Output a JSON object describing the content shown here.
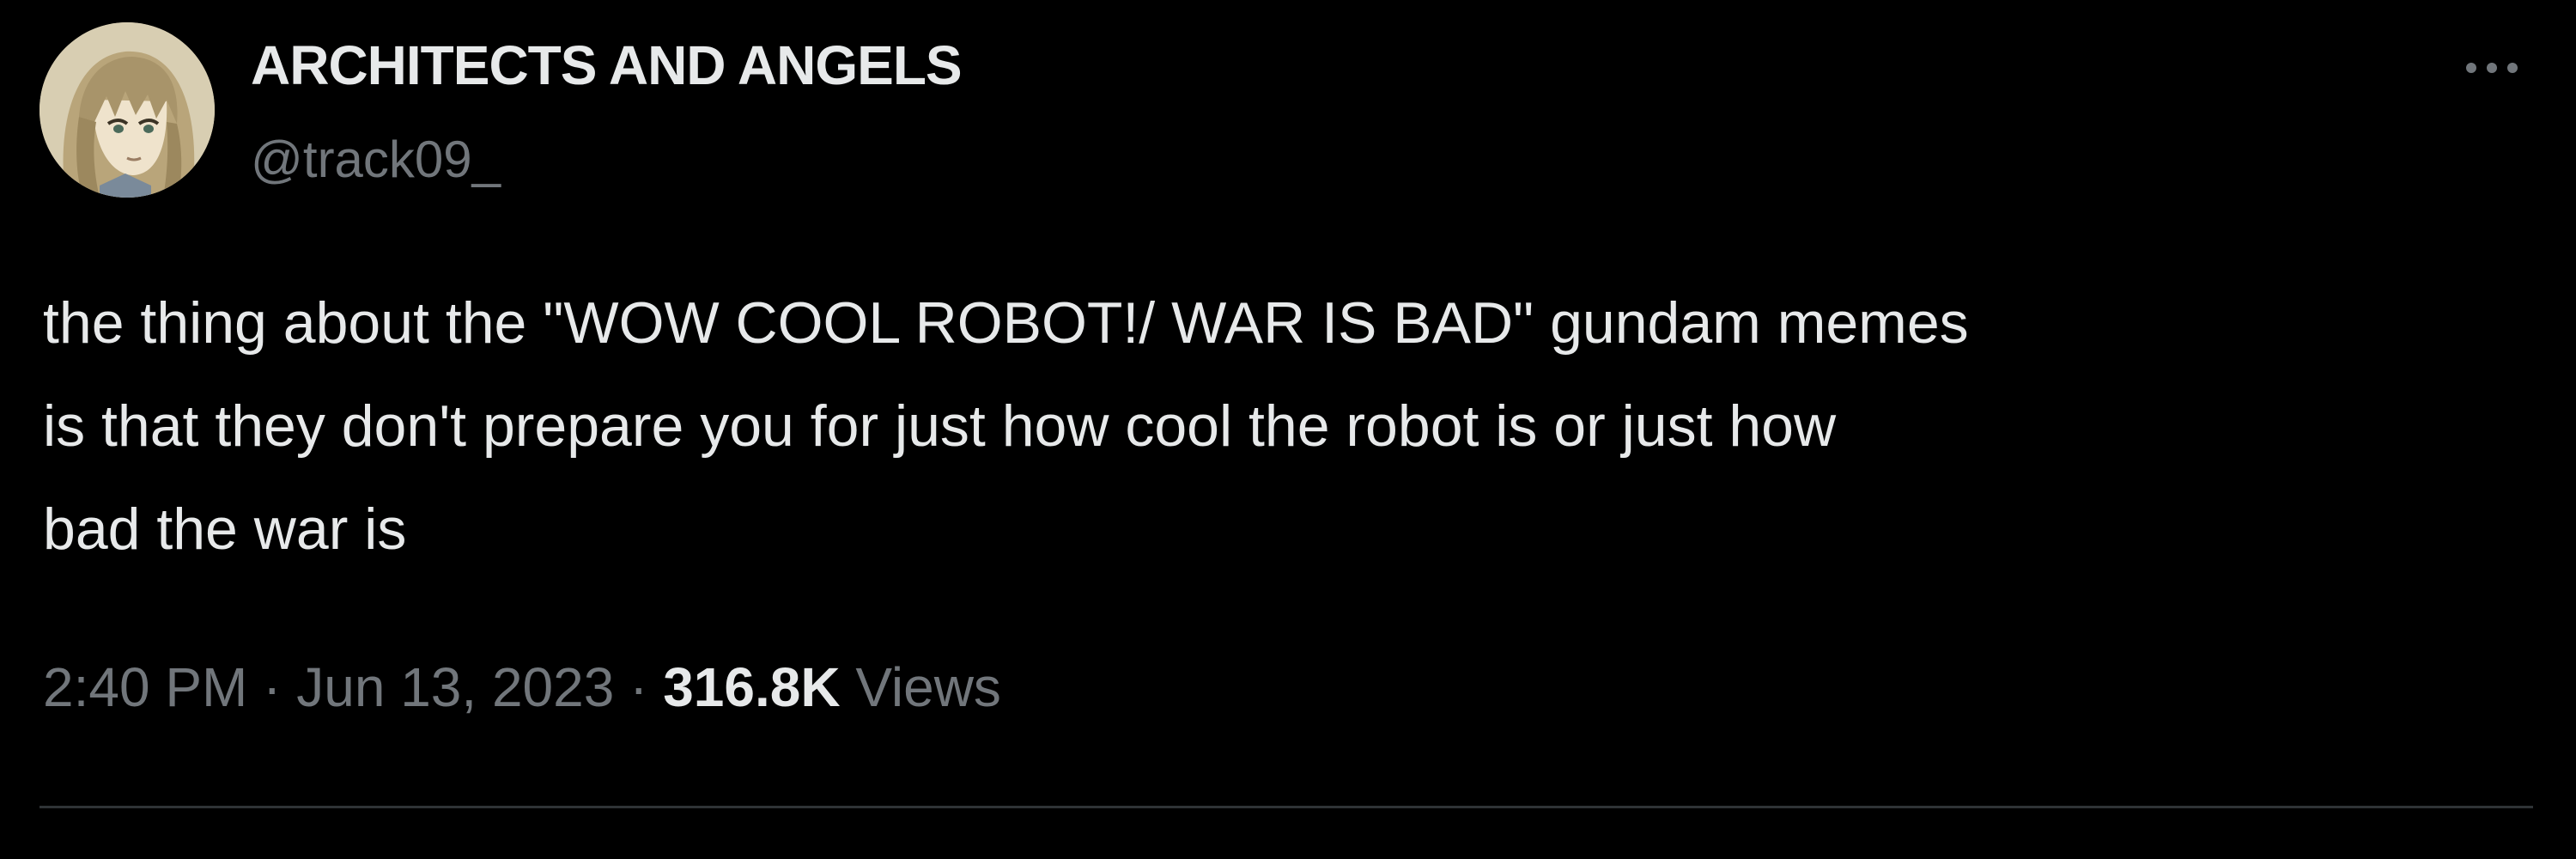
{
  "tweet": {
    "author": {
      "display_name": "ARCHITECTS AND ANGELS",
      "handle": "@track09_",
      "avatar_icon": "anime-character-avatar"
    },
    "more_icon": "more-options-icon",
    "text_lines": [
      "the thing about the \"WOW COOL ROBOT!/ WAR IS BAD\" gundam memes",
      "is that they don't prepare you for just how cool the robot is or just how",
      "bad the war is"
    ],
    "meta": {
      "time": "2:40 PM",
      "separator": "·",
      "date": "Jun 13, 2023",
      "views_count": "316.8K",
      "views_label": "Views"
    }
  },
  "colors": {
    "background": "#000000",
    "primary_text": "#e7e9ea",
    "secondary_text": "#71767b",
    "divider": "#2f3336"
  }
}
